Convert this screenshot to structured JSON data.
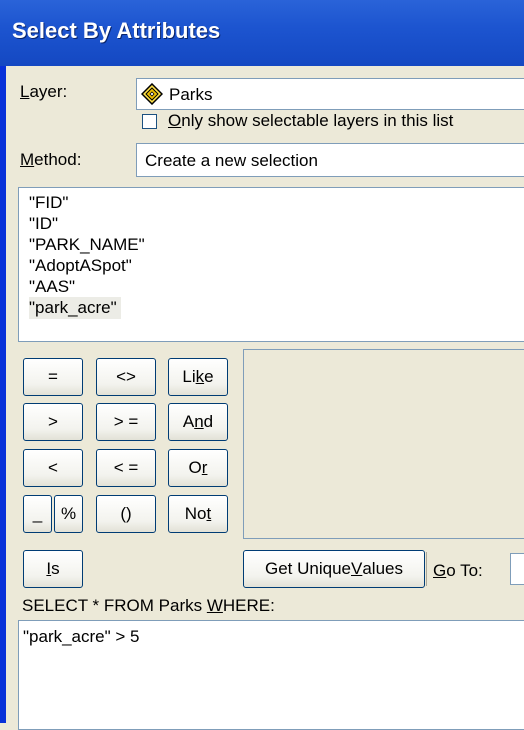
{
  "window": {
    "title": "Select By Attributes"
  },
  "layer": {
    "label_prefix": "",
    "label_u": "L",
    "label_rest": "ayer:",
    "value": "Parks",
    "icon": "layer-diamond-icon"
  },
  "only_selectable": {
    "label_u": "O",
    "label_rest": "nly show selectable layers in this list",
    "checked": false
  },
  "method": {
    "label_u": "M",
    "label_rest": "ethod:",
    "value": "Create a new selection"
  },
  "fields": [
    "\"FID\"",
    "\"ID\"",
    "\"PARK_NAME\"",
    "\"AdoptASpot\"",
    "\"AAS\"",
    "\"park_acre\""
  ],
  "selected_field_index": 5,
  "operators": {
    "eq": "=",
    "ne": "<>",
    "like_pre": "Li",
    "like_u": "k",
    "like_post": "e",
    "gt": ">",
    "ge": "> =",
    "and_pre": "A",
    "and_u": "n",
    "and_post": "d",
    "lt": "<",
    "le": "< =",
    "or_pre": "O",
    "or_u": "r",
    "underscore": "_",
    "percent": "%",
    "parens": "()",
    "not_pre": "No",
    "not_u": "t",
    "is_u": "I",
    "is_rest": "s"
  },
  "unique": {
    "pre": "Get Unique ",
    "u": "V",
    "post": "alues"
  },
  "goto": {
    "u": "G",
    "rest": "o To:"
  },
  "sql_label": {
    "pre": "SELECT * FROM Parks ",
    "u": "W",
    "post": "HERE:"
  },
  "expression": "\"park_acre\" > 5"
}
